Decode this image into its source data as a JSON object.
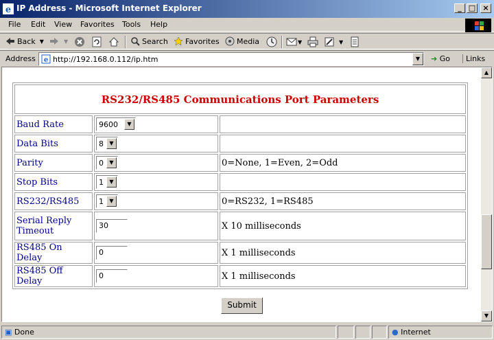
{
  "window": {
    "title": "IP Address - Microsoft Internet Explorer"
  },
  "window_buttons": {
    "minimize": "_",
    "maximize": "□",
    "close": "×"
  },
  "menu": [
    "File",
    "Edit",
    "View",
    "Favorites",
    "Tools",
    "Help"
  ],
  "toolbar": {
    "back": "Back",
    "search": "Search",
    "favorites": "Favorites",
    "media": "Media"
  },
  "address": {
    "label": "Address",
    "url": "http://192.168.0.112/ip.htm",
    "go": "Go",
    "links": "Links"
  },
  "page": {
    "title": "RS232/RS485 Communications Port Parameters",
    "rows": [
      {
        "label": "Baud Rate",
        "control": "select",
        "value": "9600",
        "desc": ""
      },
      {
        "label": "Data Bits",
        "control": "select",
        "value": "8",
        "desc": ""
      },
      {
        "label": "Parity",
        "control": "select",
        "value": "0",
        "desc": "0=None, 1=Even, 2=Odd"
      },
      {
        "label": "Stop Bits",
        "control": "select",
        "value": "1",
        "desc": ""
      },
      {
        "label": "RS232/RS485",
        "control": "select",
        "value": "1",
        "desc": "0=RS232,  1=RS485"
      },
      {
        "label": "Serial Reply Timeout",
        "control": "text",
        "value": "30",
        "desc": "X 10 milliseconds"
      },
      {
        "label": "RS485 On Delay",
        "control": "text",
        "value": "0",
        "desc": "X 1 milliseconds"
      },
      {
        "label": "RS485 Off Delay",
        "control": "text",
        "value": "0",
        "desc": "X 1 milliseconds"
      }
    ],
    "submit": "Submit"
  },
  "status": {
    "text": "Done",
    "zone": "Internet"
  },
  "colors": {
    "title_red": "#cc0000",
    "label_blue": "#000080",
    "titlebar": "#0a246a"
  }
}
